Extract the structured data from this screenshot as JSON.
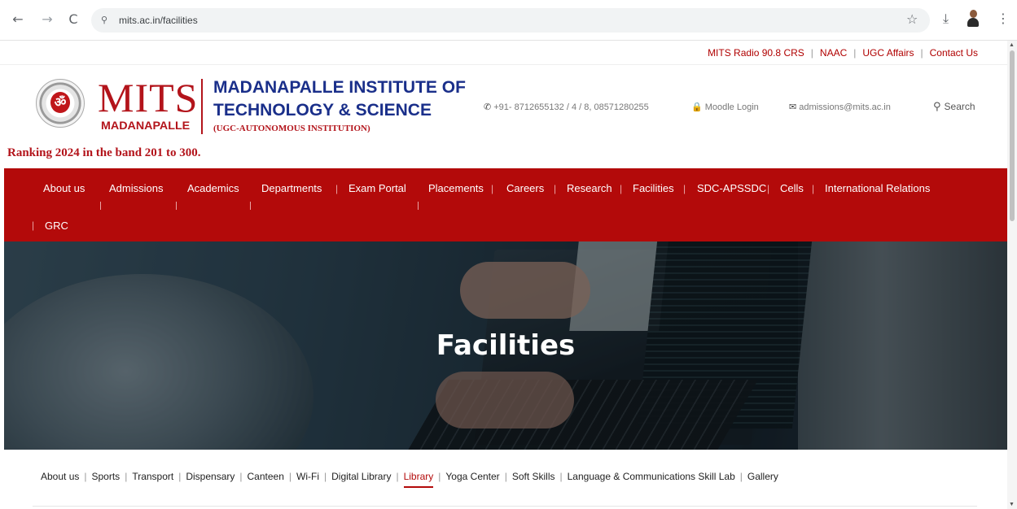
{
  "browser": {
    "url": "mits.ac.in/facilities",
    "back_glyph": "←",
    "forward_glyph": "→",
    "reload_glyph": "C",
    "site_info_glyph": "⚲",
    "bookmark_glyph": "☆",
    "download_glyph": "⤓",
    "menu_glyph": "⋮"
  },
  "top_links": [
    "MITS Radio 90.8 CRS",
    "NAAC",
    "UGC Affairs",
    "Contact Us"
  ],
  "header": {
    "logo_mits": "MITS",
    "logo_madanapalle": "MADANAPALLE",
    "emblem_glyph": "ॐ",
    "institute_line1": "MADANAPALLE INSTITUTE OF",
    "institute_line2": "TECHNOLOGY & SCIENCE",
    "institute_line3": "(UGC-AUTONOMOUS INSTITUTION)",
    "ranking": "Ranking 2024 in the band 201 to 300.",
    "phone": "+91- 8712655132 / 4 / 8, 08571280255",
    "moodle": "Moodle Login",
    "email": "admissions@mits.ac.in",
    "search": "Search",
    "phone_icon_glyph": "✆",
    "lock_icon_glyph": "🔒",
    "mail_icon_glyph": "✉",
    "search_icon_glyph": "⚲"
  },
  "nav": {
    "items": [
      "About us",
      "Admissions",
      "Academics",
      "Departments",
      "Exam Portal",
      "Placements",
      "Careers",
      "Research",
      "Facilities",
      "SDC-APSSDC",
      "Cells",
      "International Relations",
      "GRC"
    ],
    "separator": "|"
  },
  "hero": {
    "title": "Facilities"
  },
  "subnav": {
    "items": [
      "About us",
      "Sports",
      "Transport",
      "Dispensary",
      "Canteen",
      "Wi-Fi",
      "Digital Library",
      "Library",
      "Yoga Center",
      "Soft Skills",
      "Language & Communications Skill Lab",
      "Gallery"
    ],
    "active": "Library",
    "separator": "|"
  },
  "colors": {
    "brand_red": "#b30a0a",
    "brand_blue": "#1a2f8a",
    "nav_text": "#ffffff"
  }
}
